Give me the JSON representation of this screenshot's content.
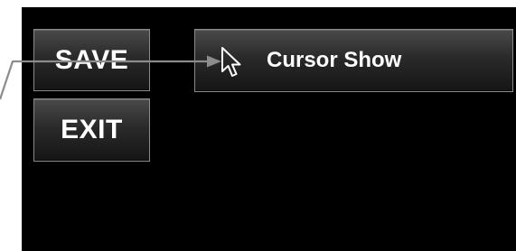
{
  "buttons": {
    "save_label": "SAVE",
    "exit_label": "EXIT"
  },
  "cursor_bar": {
    "label": "Cursor Show",
    "icon": "mouse-pointer-icon"
  },
  "annotation": {
    "icon": "callout-arrow",
    "color": "#8c8c8c"
  },
  "colors": {
    "screen_background": "#000000",
    "button_border": "#8a8a8a",
    "text": "#ffffff"
  }
}
